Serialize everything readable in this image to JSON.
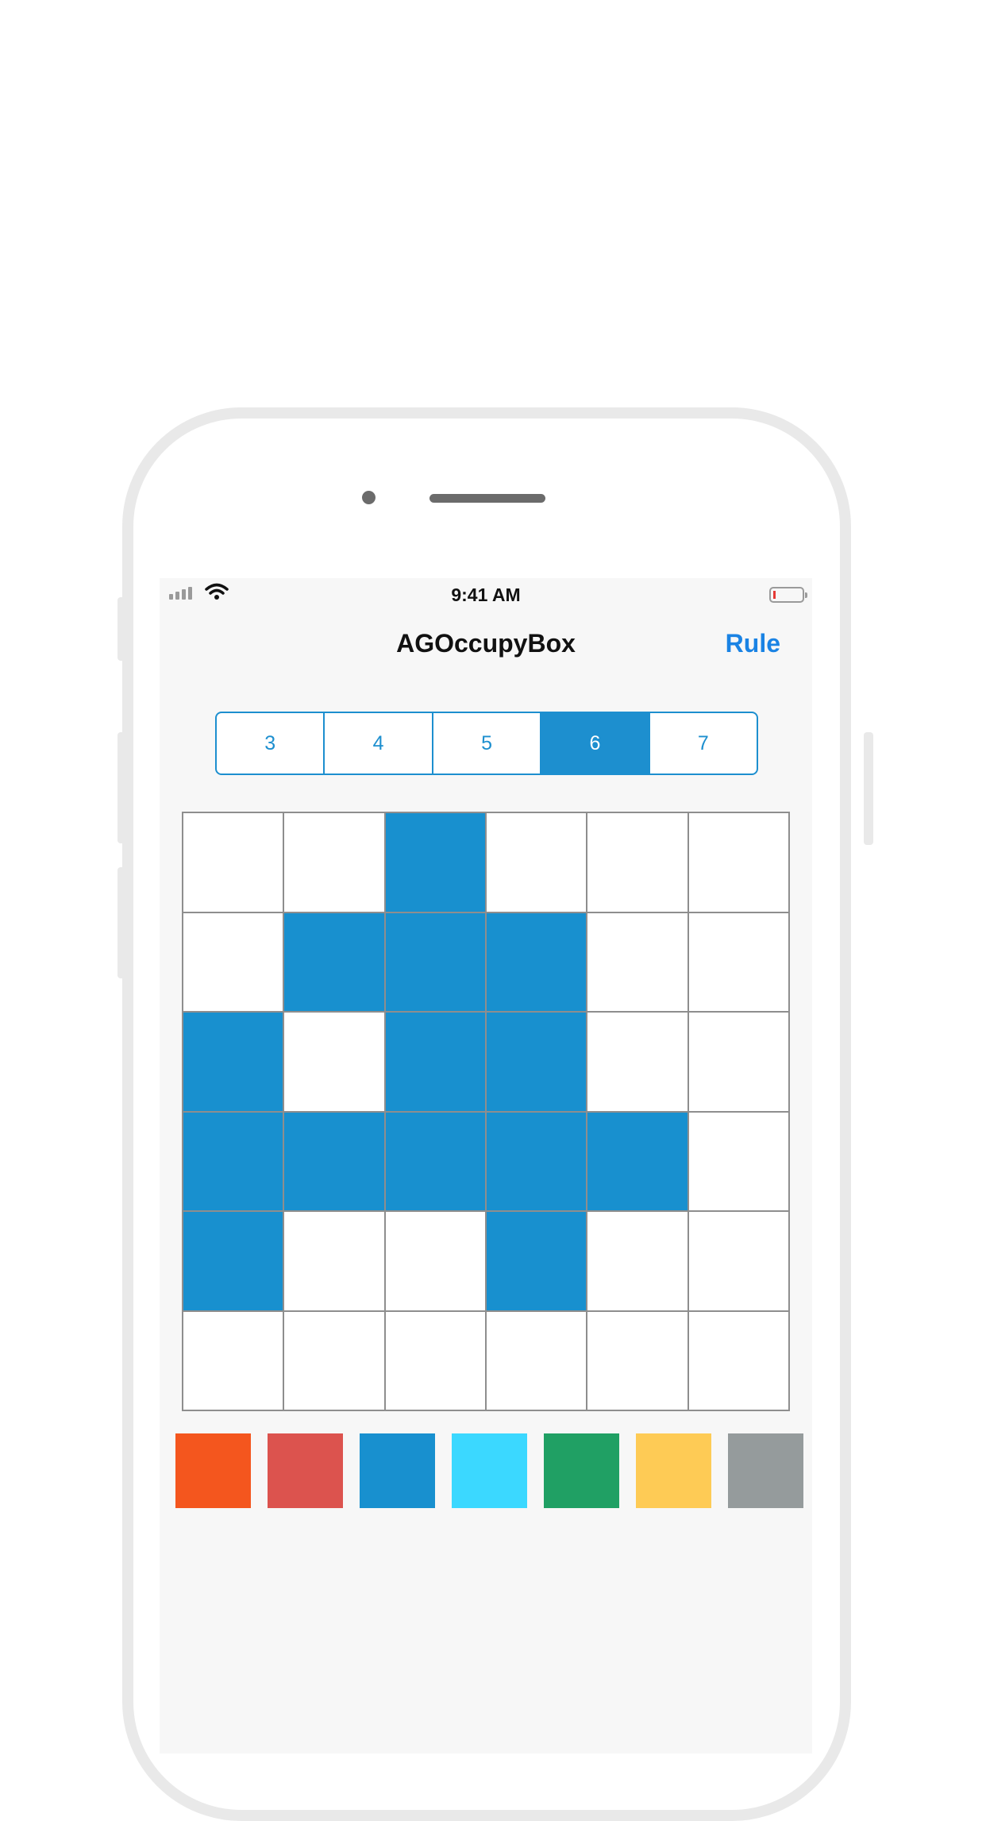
{
  "status_bar": {
    "time": "9:41 AM"
  },
  "nav": {
    "title": "AGOccupyBox",
    "rule_label": "Rule"
  },
  "segments": {
    "items": [
      "3",
      "4",
      "5",
      "6",
      "7"
    ],
    "selected": "6"
  },
  "board": {
    "size": 6,
    "fill_color": "#1890cf",
    "empty_color": "#ffffff",
    "rows": [
      [
        0,
        0,
        1,
        0,
        0,
        0
      ],
      [
        0,
        1,
        1,
        1,
        0,
        0
      ],
      [
        1,
        0,
        1,
        1,
        0,
        0
      ],
      [
        1,
        1,
        1,
        1,
        1,
        0
      ],
      [
        1,
        0,
        0,
        1,
        0,
        0
      ],
      [
        0,
        0,
        0,
        0,
        0,
        0
      ]
    ]
  },
  "palette": {
    "colors": [
      "#f4561e",
      "#dc534e",
      "#1890cf",
      "#3bd8ff",
      "#20a064",
      "#fecb55",
      "#959b9c"
    ]
  }
}
